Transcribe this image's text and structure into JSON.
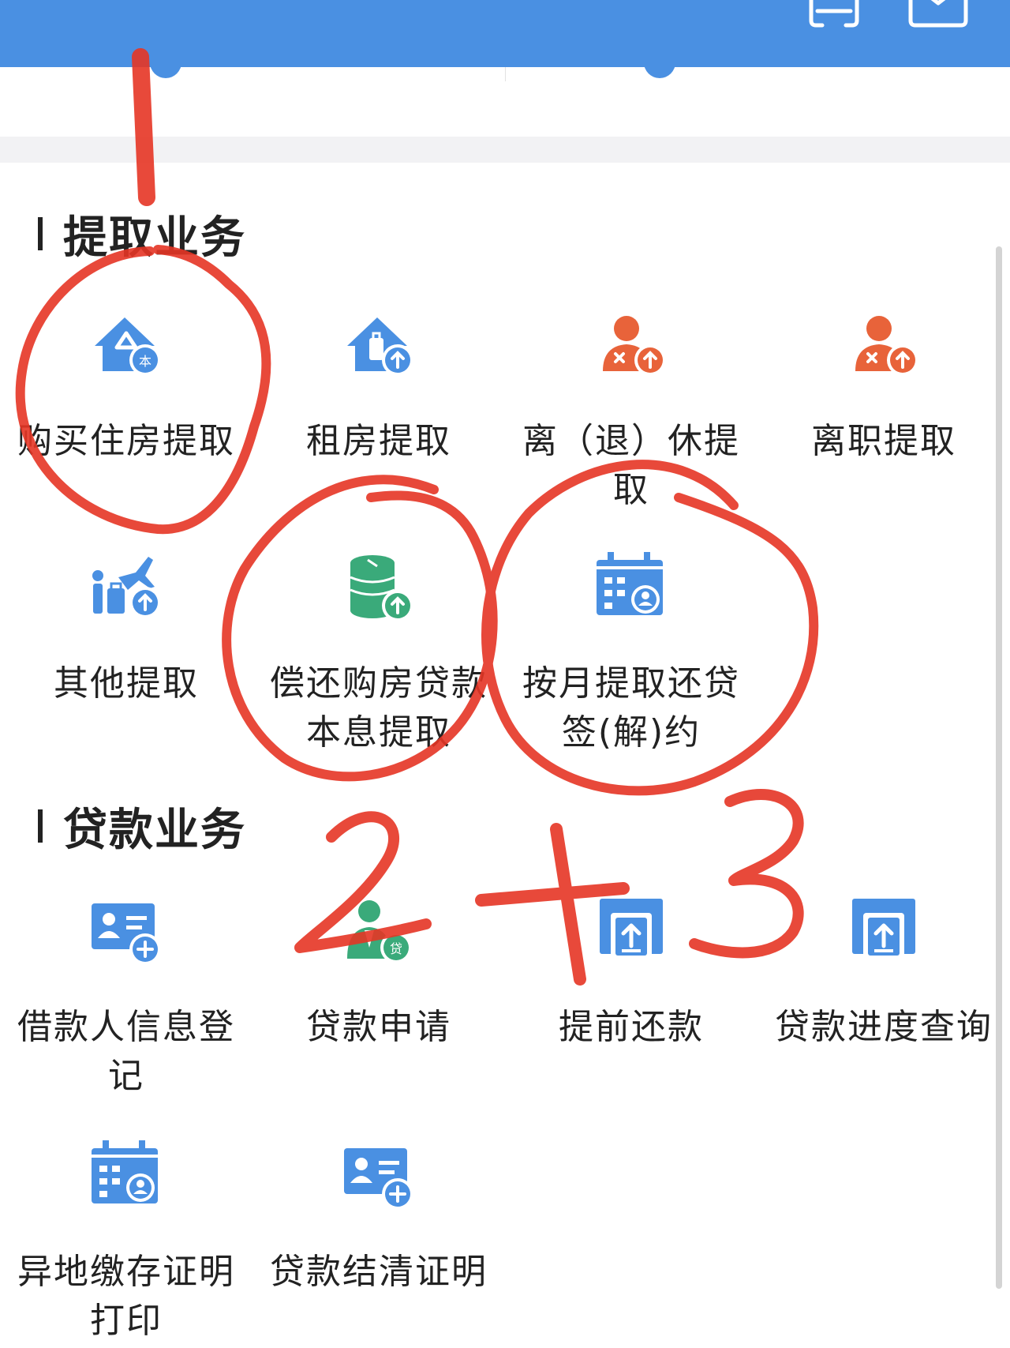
{
  "colors": {
    "header": "#4a90e2",
    "icon_blue": "#4a90e2",
    "icon_orange": "#e8633a",
    "icon_green": "#3aaa7a",
    "annotation": "#e53525",
    "text": "#222222"
  },
  "header": {
    "icons": [
      "scan-icon",
      "download-icon"
    ]
  },
  "withdraw": {
    "title": "提取业务",
    "items": [
      {
        "label": "购买住房提取",
        "icon": "house-purchase-icon"
      },
      {
        "label": "租房提取",
        "icon": "rent-house-icon"
      },
      {
        "label": "离（退）休提取",
        "icon": "retire-person-icon"
      },
      {
        "label": "离职提取",
        "icon": "resign-person-icon"
      },
      {
        "label": "其他提取",
        "icon": "plane-luggage-icon"
      },
      {
        "label": "偿还购房贷款本息提取",
        "icon": "coin-stack-icon"
      },
      {
        "label": "按月提取还贷签(解)约",
        "icon": "calendar-person-icon"
      }
    ]
  },
  "loan": {
    "title": "贷款业务",
    "items": [
      {
        "label": "借款人信息登记",
        "icon": "id-card-add-icon"
      },
      {
        "label": "贷款申请",
        "icon": "loan-person-icon"
      },
      {
        "label": "提前还款",
        "icon": "upload-tray-icon"
      },
      {
        "label": "贷款进度查询",
        "icon": "upload-tray-icon"
      },
      {
        "label": "异地缴存证明打印",
        "icon": "calendar-person-icon"
      },
      {
        "label": "贷款结清证明",
        "icon": "id-card-add-icon"
      }
    ]
  },
  "annotations": {
    "marks": [
      "1",
      "2",
      "+",
      "3"
    ]
  }
}
